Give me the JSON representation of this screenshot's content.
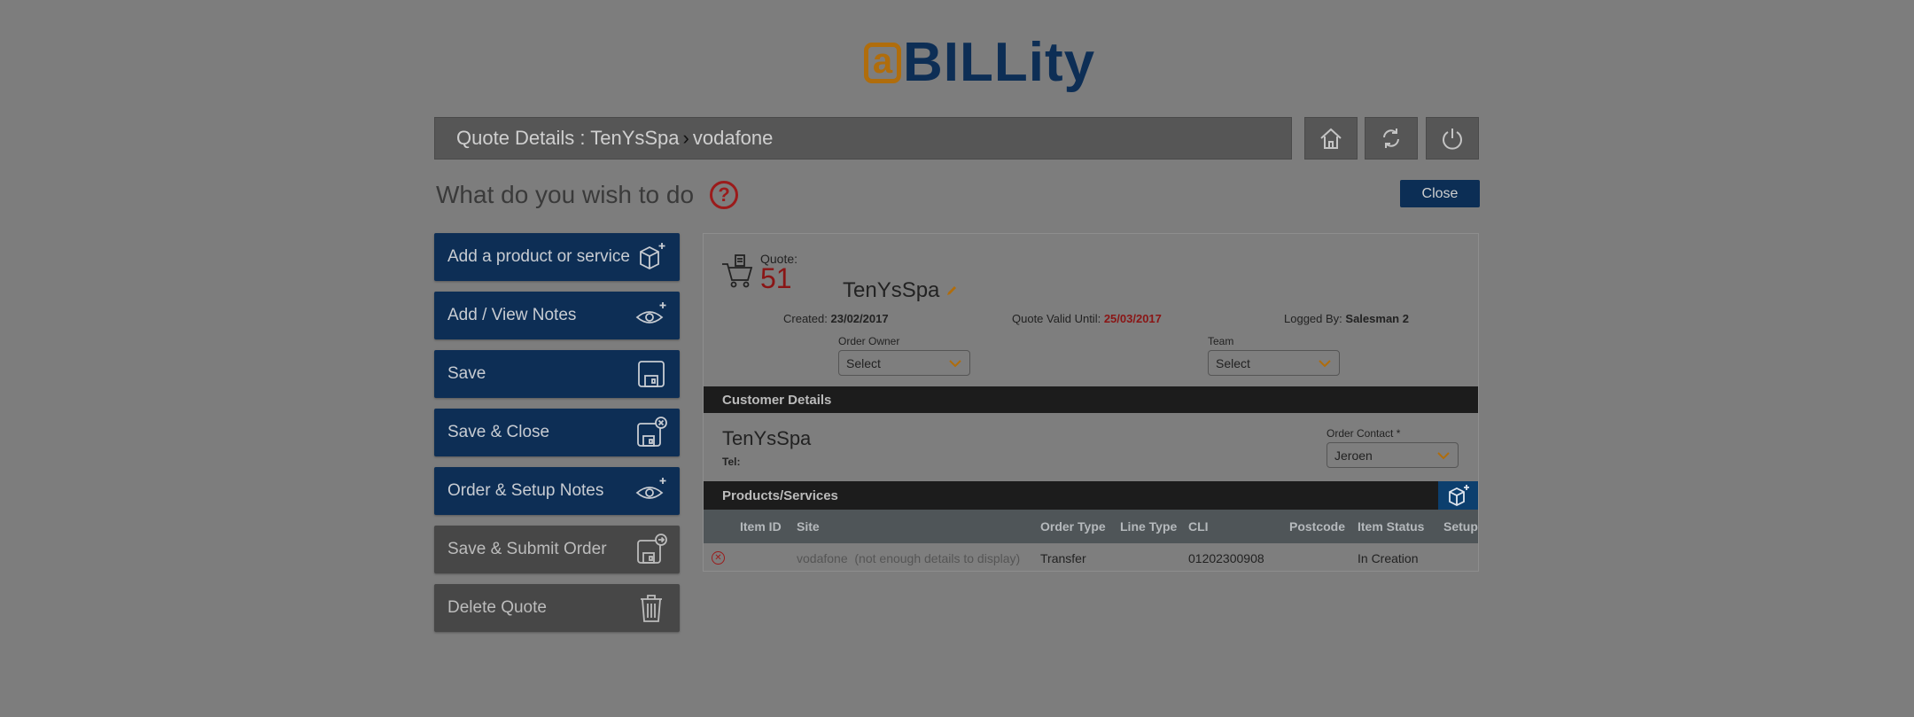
{
  "logo": {
    "mark": "a",
    "text": "BILLity"
  },
  "header": {
    "title": "Quote Details : TenYsSpa",
    "separator": "›",
    "subtitle": "vodafone",
    "icons": [
      "home-icon",
      "refresh-icon",
      "power-icon"
    ]
  },
  "prompt": {
    "text": "What do you wish to do",
    "help": "?"
  },
  "close_label": "Close",
  "actions": [
    {
      "label": "Add a product or service",
      "icon": "cube-plus-icon",
      "style": "blue"
    },
    {
      "label": "Add / View Notes",
      "icon": "eye-plus-icon",
      "style": "blue"
    },
    {
      "label": "Save",
      "icon": "floppy-icon",
      "style": "blue"
    },
    {
      "label": "Save & Close",
      "icon": "floppy-close-icon",
      "style": "blue"
    },
    {
      "label": "Order & Setup Notes",
      "icon": "eye-plus-icon",
      "style": "blue"
    },
    {
      "label": "Save & Submit Order",
      "icon": "floppy-submit-icon",
      "style": "grey"
    },
    {
      "label": "Delete Quote",
      "icon": "trash-icon",
      "style": "grey"
    }
  ],
  "quote": {
    "label": "Quote:",
    "number": "51",
    "customer": "TenYsSpa",
    "created_label": "Created:",
    "created": "23/02/2017",
    "valid_label": "Quote Valid Until:",
    "valid_until": "25/03/2017",
    "logged_label": "Logged By:",
    "logged_by": "Salesman 2",
    "order_owner_label": "Order Owner",
    "order_owner_value": "Select",
    "team_label": "Team",
    "team_value": "Select"
  },
  "customer_details": {
    "header": "Customer Details",
    "name": "TenYsSpa",
    "tel_label": "Tel:",
    "order_contact_label": "Order Contact *",
    "order_contact_value": "Jeroen"
  },
  "products": {
    "header": "Products/Services",
    "columns": [
      "Item ID",
      "Site",
      "Order Type",
      "Line Type",
      "CLI",
      "Postcode",
      "Item Status",
      "Setup"
    ],
    "rows": [
      {
        "item_id": "",
        "site": "vodafone",
        "site_note": "(not enough details to display)",
        "order_type": "Transfer",
        "line_type": "",
        "cli": "01202300908",
        "postcode": "",
        "item_status": "In Creation",
        "setup": ""
      }
    ]
  },
  "colors": {
    "brand_blue": "#0d2e55",
    "brand_orange": "#b06d0c",
    "alert_red": "#8a1515"
  }
}
